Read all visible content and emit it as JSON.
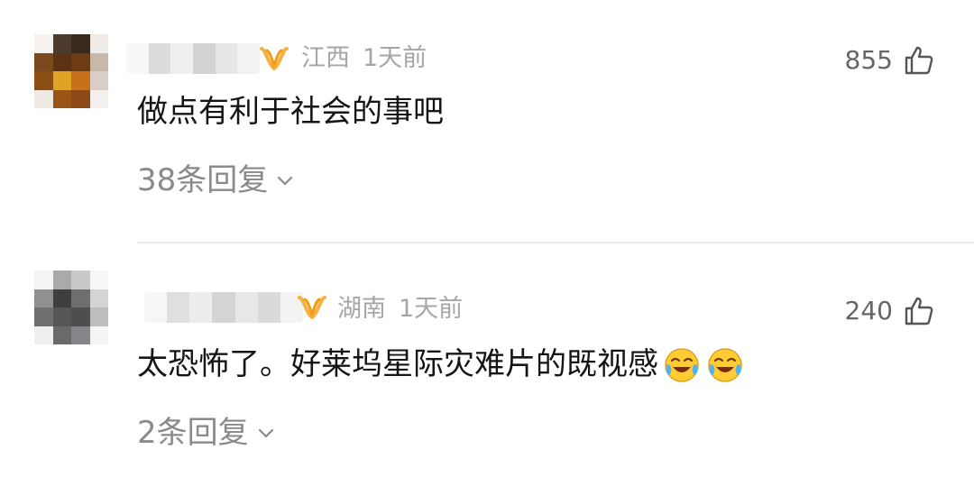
{
  "comments": [
    {
      "location": "江西",
      "time": "1天前",
      "likes": "855",
      "text": "做点有利于社会的事吧",
      "replies": "38条回复",
      "emoji_count": 0,
      "avatar_colors": [
        "#f6f2ef",
        "#4c3a2c",
        "#3a2a1e",
        "#f1ece8",
        "#7a4a1c",
        "#5b3214",
        "#6e3c12",
        "#c8b8aa",
        "#8a4d14",
        "#e0a424",
        "#c7721a",
        "#d9cfc6",
        "#efe9e4",
        "#9a5418",
        "#8d4a16",
        "#f3efec"
      ]
    },
    {
      "location": "湖南",
      "time": "1天前",
      "likes": "240",
      "text": "太恐怖了。好莱坞星际灾难片的既视感",
      "replies": "2条回复",
      "emoji_count": 2,
      "avatar_colors": [
        "#f4f4f4",
        "#a9aaa9",
        "#c9c9c8",
        "#f6f6f6",
        "#8f908f",
        "#3c3f3b",
        "#6e706e",
        "#d4d4d4",
        "#6f6f6f",
        "#565656",
        "#4e4e4e",
        "#bdbdbd",
        "#efefef",
        "#6a6a6c",
        "#86858a",
        "#f5f5f5"
      ]
    }
  ],
  "colors": {
    "meta": "#a6a6a6",
    "badge_orange": "#f5a623",
    "divider": "#ececec"
  },
  "icons": {
    "like": "thumbs-up-icon",
    "expand": "chevron-down-icon",
    "badge": "vip-badge-icon",
    "emoji": "laugh-cry-emoji"
  }
}
